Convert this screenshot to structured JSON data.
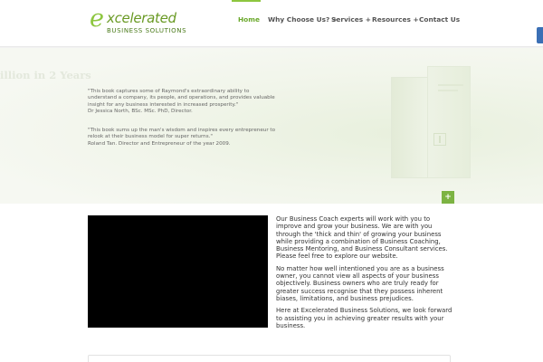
{
  "logo": {
    "letter": "e",
    "word": "xcelerated",
    "tagline": "BUSINESS SOLUTIONS"
  },
  "nav": {
    "items": [
      {
        "label": "Home",
        "has_submenu": false,
        "active": true
      },
      {
        "label": "Why Choose Us?",
        "has_submenu": true,
        "active": false
      },
      {
        "label": "Services",
        "has_submenu": true,
        "active": false
      },
      {
        "label": "Resources",
        "has_submenu": true,
        "active": false
      },
      {
        "label": "Contact Us",
        "has_submenu": false,
        "active": false
      }
    ],
    "submenu_marker": "+"
  },
  "hero": {
    "title": "illion in 2 Years",
    "quotes": [
      {
        "text": "\"This book captures some of Raymond's extraordinary ability to understand a company, its people, and operations, and provides valuable insight for any business interested in increased prosperity.\"",
        "author": "Dr Jessica North, BSc. MSc. PhD, Director."
      },
      {
        "text": "\"This book sums up the man's wisdom and inspires every entrepreneur to relook at their business model for super returns.\"",
        "author": "Roland Tan. Director and Entrepreneur of the year 2009."
      }
    ],
    "button_label": "+"
  },
  "content": {
    "paragraphs": [
      "Our Business Coach experts will work with you to improve and grow your business. We are with you through the 'thick and thin' of growing your business while providing a combination of Business Coaching, Business Mentoring, and Business Consultant services. Please feel free to explore our website.",
      "No matter how well intentioned you are as a business owner, you cannot view all aspects of your business objectively. Business owners who are truly ready for greater success recognise that they possess inherent biases, limitations, and business prejudices.",
      "Here at Excelerated Business Solutions, we look forward to assisting you in achieving greater results with your business."
    ]
  },
  "colors": {
    "brand_green": "#8dc63f",
    "nav_active": "#6aa82b",
    "side_tab": "#3b6fb5"
  }
}
